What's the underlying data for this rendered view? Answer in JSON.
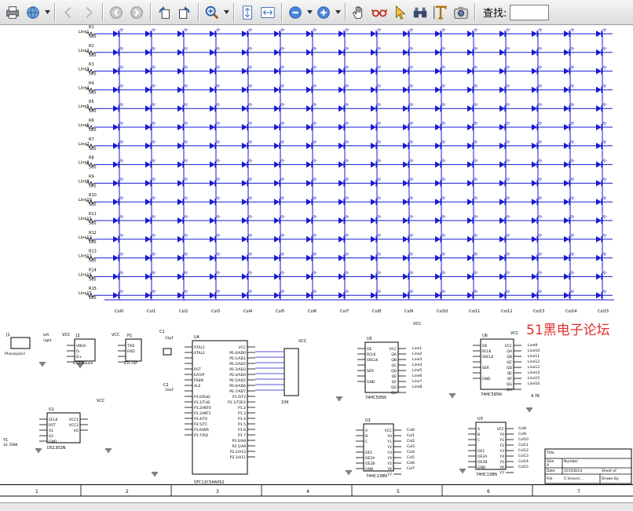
{
  "toolbar": {
    "buttons": [
      {
        "name": "print-button",
        "icon": "printer-icon"
      },
      {
        "name": "web-button",
        "icon": "globe-icon",
        "dropdown": true
      },
      {
        "name": "prev-page-button",
        "icon": "chevron-left-icon"
      },
      {
        "name": "next-page-button",
        "icon": "chevron-right-icon"
      },
      {
        "name": "back-button",
        "icon": "back-circle-icon"
      },
      {
        "name": "forward-button",
        "icon": "forward-circle-icon"
      },
      {
        "name": "rotate-ccw-button",
        "icon": "rotate-ccw-icon"
      },
      {
        "name": "rotate-cw-button",
        "icon": "rotate-cw-icon"
      },
      {
        "name": "zoom-tool-button",
        "icon": "magnifier-icon",
        "dropdown": true
      },
      {
        "name": "fit-page-button",
        "icon": "fit-page-icon"
      },
      {
        "name": "fit-width-button",
        "icon": "fit-width-icon"
      },
      {
        "name": "zoom-out-button",
        "icon": "zoom-out-icon",
        "dropdown": true
      },
      {
        "name": "zoom-in-button",
        "icon": "zoom-in-icon",
        "dropdown": true
      },
      {
        "name": "hand-tool-button",
        "icon": "hand-icon"
      },
      {
        "name": "glasses-button",
        "icon": "glasses-icon"
      },
      {
        "name": "select-tool-button",
        "icon": "arrow-pointer-icon"
      },
      {
        "name": "binoculars-button",
        "icon": "binoculars-icon"
      },
      {
        "name": "text-tool-button",
        "icon": "text-cursor-icon"
      },
      {
        "name": "snapshot-button",
        "icon": "camera-icon"
      }
    ],
    "find_label": "查找:",
    "find_value": ""
  },
  "colors": {
    "accent": "#1a1ad0",
    "watermark": "#e0302a",
    "toolbar_bg": "#e6e6e6"
  },
  "watermark": "51黑电子论坛",
  "schematic": {
    "row_label_prefix": "Line",
    "resistor_value": "560",
    "column_label_prefix": "Col",
    "mcu": "STC12C5A60S2",
    "shift_registers": [
      "74HC595N",
      "74HC595N"
    ],
    "counters": [
      "74HC138N",
      "74HC138N"
    ],
    "rtc": "DS1302N",
    "crystal": "32.768K",
    "rpack_value": "10K",
    "power_net": "VCC",
    "ground_net": "GND",
    "title_block": {
      "title": "Title",
      "size_label": "Size",
      "size_value": "A",
      "number_label": "Number",
      "date_label": "Date",
      "date_value": "2015/8/14",
      "file_label": "File",
      "file_value": "C:\\Users\\...",
      "sheet_label": "Sheet of",
      "drawn_label": "Drawn By"
    },
    "border_numbers": [
      "1",
      "2",
      "3",
      "4",
      "5",
      "6",
      "7"
    ]
  }
}
